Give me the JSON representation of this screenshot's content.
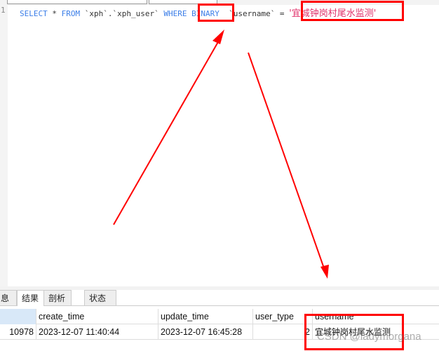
{
  "editor": {
    "line_number": "1",
    "sql": {
      "kw_select": "SELECT",
      "star": " * ",
      "kw_from": "FROM",
      "table": " `xph`.`xph_user` ",
      "kw_where": "WHERE",
      "space": " ",
      "kw_binary": "BINARY",
      "column": "  `username` = ",
      "value": "'宜城钟岗村尾水监测'"
    }
  },
  "result_tabs": [
    {
      "label": "息"
    },
    {
      "label": "结果 1",
      "active": true
    },
    {
      "label": "剖析"
    },
    {
      "label": "状态"
    }
  ],
  "table": {
    "columns": [
      "",
      "create_time",
      "update_time",
      "user_type",
      "username"
    ],
    "rows": [
      [
        "10978",
        "2023-12-07 11:40:44",
        "2023-12-07 16:45:28",
        "2",
        "宜城钟岗村尾水监测"
      ]
    ]
  },
  "watermark": "CSDN @ladymorgana",
  "colors": {
    "keyword": "#3b7ee8",
    "string": "#e0306a",
    "annotation": "#ff0000"
  }
}
